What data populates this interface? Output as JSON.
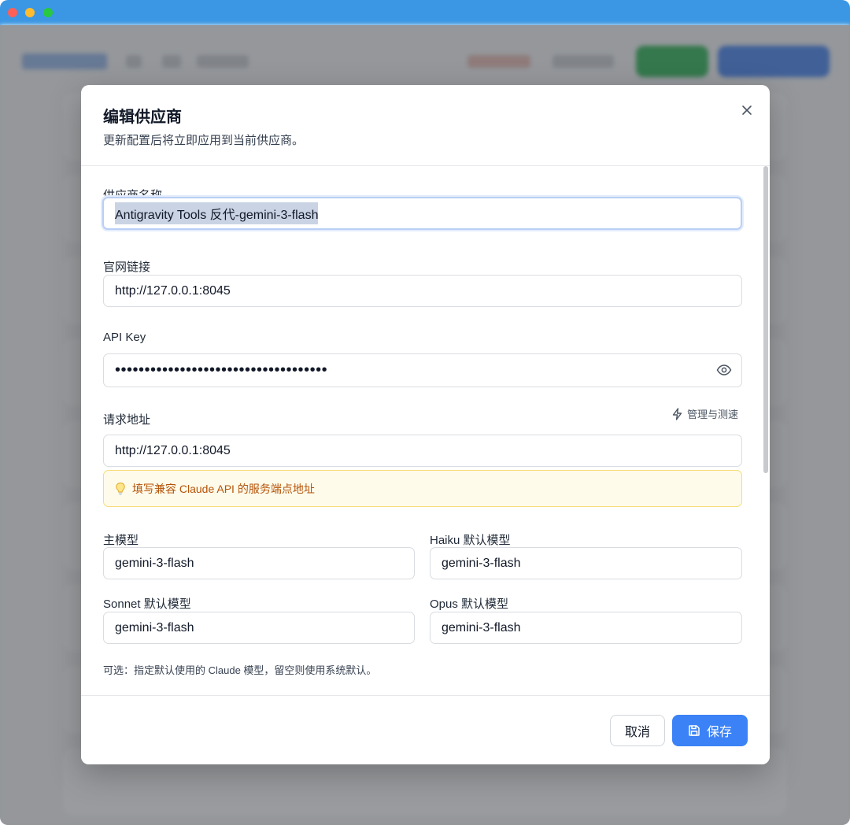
{
  "modal": {
    "title": "编辑供应商",
    "subtitle": "更新配置后将立即应用到当前供应商。"
  },
  "fields": {
    "provider_name": {
      "label": "供应商名称",
      "value": "Antigravity Tools 反代-gemini-3-flash"
    },
    "website": {
      "label": "官网链接",
      "value": "http://127.0.0.1:8045"
    },
    "api_key": {
      "label": "API Key",
      "value": "••••••••••••••••••••••••••••••••••••"
    },
    "request_url": {
      "label": "请求地址",
      "value": "http://127.0.0.1:8045",
      "action": "管理与测速"
    },
    "hint": "填写兼容 Claude API 的服务端点地址",
    "main_model": {
      "label": "主模型",
      "value": "gemini-3-flash"
    },
    "haiku_model": {
      "label": "Haiku 默认模型",
      "value": "gemini-3-flash"
    },
    "sonnet_model": {
      "label": "Sonnet 默认模型",
      "value": "gemini-3-flash"
    },
    "opus_model": {
      "label": "Opus 默认模型",
      "value": "gemini-3-flash"
    },
    "model_note": "可选：指定默认使用的 Claude 模型，留空则使用系统默认。"
  },
  "footer": {
    "cancel_label": "取消",
    "save_label": "保存"
  },
  "icons": [
    "close-icon",
    "eye-icon",
    "lightning-icon",
    "lightbulb-icon",
    "save-icon"
  ],
  "colors": {
    "primary": "#3b82f6",
    "hint_bg": "#fffbea",
    "hint_text": "#b45309",
    "titlebar": "#3b97e3"
  }
}
